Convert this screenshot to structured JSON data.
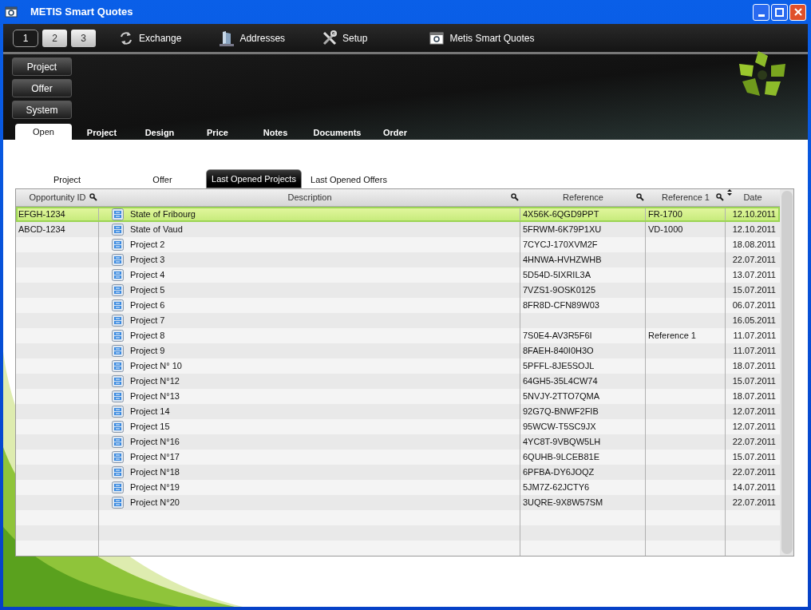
{
  "window": {
    "title": "METIS Smart Quotes"
  },
  "toolbar": {
    "pages": [
      {
        "label": "1",
        "selected": true
      },
      {
        "label": "2",
        "selected": false
      },
      {
        "label": "3",
        "selected": false
      }
    ],
    "items": [
      {
        "kind": "exchange",
        "label": "Exchange"
      },
      {
        "kind": "addresses",
        "label": "Addresses"
      },
      {
        "kind": "setup",
        "label": "Setup"
      },
      {
        "kind": "app",
        "label": "Metis Smart Quotes"
      }
    ]
  },
  "side_buttons": [
    "Project",
    "Offer",
    "System"
  ],
  "main_tabs": [
    {
      "label": "Open",
      "selected": true
    },
    {
      "label": "Project",
      "selected": false
    },
    {
      "label": "Design",
      "selected": false
    },
    {
      "label": "Price",
      "selected": false
    },
    {
      "label": "Notes",
      "selected": false
    },
    {
      "label": "Documents",
      "selected": false
    },
    {
      "label": "Order",
      "selected": false
    }
  ],
  "sub_tabs": [
    {
      "label": "Project",
      "selected": false
    },
    {
      "label": "Offer",
      "selected": false
    },
    {
      "label": "Last Opened Projects",
      "selected": true
    },
    {
      "label": "Last Opened Offers",
      "selected": false
    }
  ],
  "table": {
    "columns": [
      {
        "label": "Opportunity ID",
        "filter": true
      },
      {
        "label": "Description",
        "filter": true
      },
      {
        "label": "Reference",
        "filter": true
      },
      {
        "label": "Reference 1",
        "filter": true
      },
      {
        "label": "Date",
        "sort": true
      }
    ],
    "rows": [
      {
        "opportunity_id": "EFGH-1234",
        "description": "State of Fribourg",
        "reference": "4X56K-6QGD9PPT",
        "reference_1": "FR-1700",
        "date": "12.10.2011",
        "selected": true
      },
      {
        "opportunity_id": "ABCD-1234",
        "description": "State of Vaud",
        "reference": "5FRWM-6K79P1XU",
        "reference_1": "VD-1000",
        "date": "12.10.2011",
        "selected": false
      },
      {
        "description": "Project 2",
        "reference": "7CYCJ-170XVM2F",
        "date": "18.08.2011",
        "selected": false
      },
      {
        "description": "Project 3",
        "reference": "4HNWA-HVHZWHB",
        "date": "22.07.2011",
        "selected": false
      },
      {
        "description": "Project 4",
        "reference": "5D54D-5IXRIL3A",
        "date": "13.07.2011",
        "selected": false
      },
      {
        "description": "Project 5",
        "reference": "7VZS1-9OSK0125",
        "date": "15.07.2011",
        "selected": false
      },
      {
        "description": "Project 6",
        "reference": "8FR8D-CFN89W03",
        "date": "06.07.2011",
        "selected": false
      },
      {
        "description": "Project 7",
        "date": "16.05.2011",
        "selected": false
      },
      {
        "description": "Project 8",
        "reference": "7S0E4-AV3R5F6I",
        "reference_1": "Reference 1",
        "date": "11.07.2011",
        "selected": false
      },
      {
        "description": "Project 9",
        "reference": "8FAEH-840I0H3O",
        "date": "11.07.2011",
        "selected": false
      },
      {
        "description": "Project N° 10",
        "reference": "5PFFL-8JE5SOJL",
        "date": "18.07.2011",
        "selected": false
      },
      {
        "description": "Project N°12",
        "reference": "64GH5-35L4CW74",
        "date": "15.07.2011",
        "selected": false
      },
      {
        "description": "Project N°13",
        "reference": "5NVJY-2TTO7QMA",
        "date": "18.07.2011",
        "selected": false
      },
      {
        "description": "Project 14",
        "reference": "92G7Q-BNWF2FIB",
        "date": "12.07.2011",
        "selected": false
      },
      {
        "description": "Project 15",
        "reference": "95WCW-T5SC9JX",
        "date": "12.07.2011",
        "selected": false
      },
      {
        "description": "Project N°16",
        "reference": "4YC8T-9VBQW5LH",
        "date": "22.07.2011",
        "selected": false
      },
      {
        "description": "Project N°17",
        "reference": "6QUHB-9LCEB81E",
        "date": "15.07.2011",
        "selected": false
      },
      {
        "description": "Project N°18",
        "reference": "6PFBA-DY6JOQZ",
        "date": "22.07.2011",
        "selected": false
      },
      {
        "description": "Project N°19",
        "reference": "5JM7Z-62JCTY6",
        "date": "14.07.2011",
        "selected": false
      },
      {
        "description": "Project N°20",
        "reference": "3UQRE-9X8W57SM",
        "date": "22.07.2011",
        "selected": false
      }
    ]
  }
}
